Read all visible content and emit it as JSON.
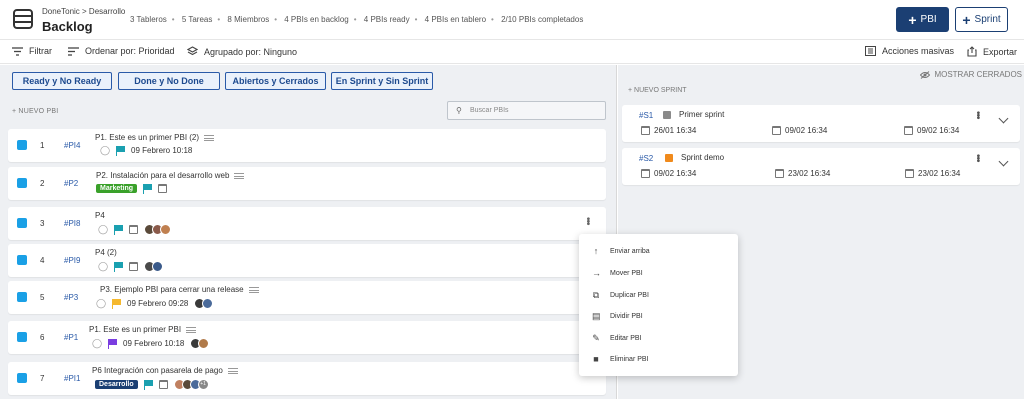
{
  "header": {
    "breadcrumb": "DoneTonic > Desarrollo",
    "title": "Backlog",
    "stats": [
      "3 Tableros",
      "5 Tareas",
      "8 Miembros",
      "4 PBIs en backlog",
      "4 PBIs ready",
      "4 PBIs en tablero",
      "2/10 PBIs completados"
    ],
    "btn_pbi": "PBI",
    "btn_sprint": "Sprint"
  },
  "toolbar": {
    "filter": "Filtrar",
    "order": "Ordenar por: Prioridad",
    "group": "Agrupado por: Ninguno",
    "bulk": "Acciones masivas",
    "export": "Exportar"
  },
  "filters": [
    "Ready y No Ready",
    "Done y No Done",
    "Abiertos y Cerrados",
    "En Sprint y Sin Sprint"
  ],
  "backlog": {
    "new_label": "+ NUEVO PBI",
    "search_placeholder": "Buscar PBIs",
    "items": [
      {
        "num": "1",
        "code": "#PI4",
        "title": "P1. Este es un primer PBI (2)",
        "date": "09 Febrero 10:18",
        "flag_color": "#1aa0b0",
        "label": "",
        "label_color": ""
      },
      {
        "num": "2",
        "code": "#P2",
        "title": "P2. Instalación para el desarrollo web",
        "date": "",
        "flag_color": "#1aa0b0",
        "label": "Marketing",
        "label_color": "#3aa12a"
      },
      {
        "num": "3",
        "code": "#PI8",
        "title": "P4",
        "date": "",
        "flag_color": "#1aa0b0",
        "label": "",
        "label_color": ""
      },
      {
        "num": "4",
        "code": "#PI9",
        "title": "P4 (2)",
        "date": "",
        "flag_color": "#1aa0b0",
        "label": "",
        "label_color": ""
      },
      {
        "num": "5",
        "code": "#P3",
        "title": "P3. Ejemplo PBI para cerrar una release",
        "date": "09 Febrero 09:28",
        "flag_color": "#f5b82e",
        "label": "",
        "label_color": ""
      },
      {
        "num": "6",
        "code": "#P1",
        "title": "P1. Este es un primer PBI",
        "date": "09 Febrero 10:18",
        "flag_color": "#7a3de0",
        "label": "",
        "label_color": ""
      },
      {
        "num": "7",
        "code": "#PI1",
        "title": "P6 Integración con pasarela de pago",
        "date": "",
        "flag_color": "#1aa0b0",
        "label": "Desarrollo",
        "label_color": "#1b3f73"
      }
    ],
    "extra_avatars": "+1"
  },
  "context_menu": {
    "items": [
      {
        "label": "Enviar arriba",
        "icon": "arrow-up-icon"
      },
      {
        "label": "Mover PBI",
        "icon": "arrow-right-icon"
      },
      {
        "label": "Duplicar PBI",
        "icon": "copy-icon"
      },
      {
        "label": "Dividir PBI",
        "icon": "split-icon"
      },
      {
        "label": "Editar PBI",
        "icon": "pencil-icon"
      },
      {
        "label": "Eliminar PBI",
        "icon": "trash-icon"
      }
    ]
  },
  "sprints": {
    "show_closed": "MOSTRAR CERRADOS",
    "new_label": "+ NUEVO SPRINT",
    "items": [
      {
        "code": "#S1",
        "name": "Primer sprint",
        "color": "#8a8a8a",
        "start": "26/01 16:34",
        "end": "09/02 16:34",
        "due": "09/02 16:34"
      },
      {
        "code": "#S2",
        "name": "Sprint demo",
        "color": "#f08a1c",
        "start": "09/02 16:34",
        "end": "23/02 16:34",
        "due": "23/02 16:34"
      }
    ]
  },
  "colors": {
    "primary": "#1b3f73",
    "check": "#1aa0e6",
    "link": "#2a5aa8"
  }
}
